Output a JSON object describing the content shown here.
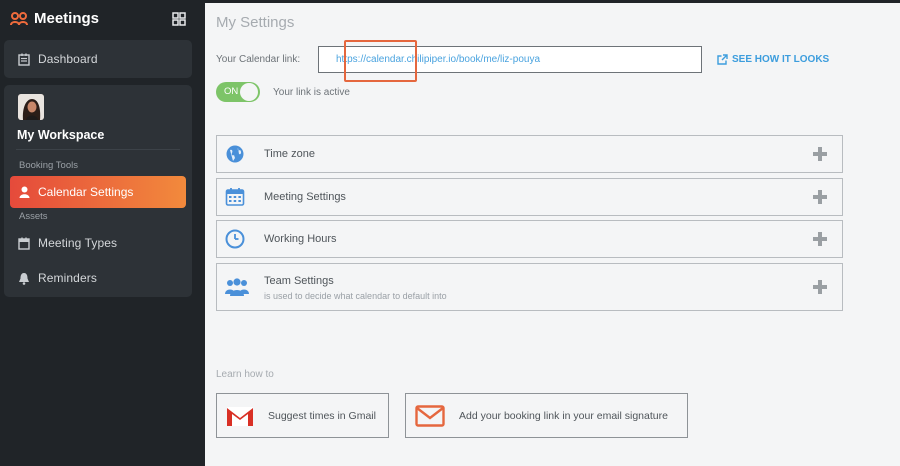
{
  "sidebar": {
    "brand": "Meetings",
    "nav": {
      "dashboard": "Dashboard"
    },
    "workspace": {
      "title": "My Workspace",
      "sections": {
        "booking_tools": "Booking Tools",
        "assets": "Assets"
      },
      "items": {
        "calendar_settings": "Calendar Settings",
        "meeting_types": "Meeting Types",
        "reminders": "Reminders"
      }
    }
  },
  "main": {
    "title": "My Settings",
    "calendar_label": "Your Calendar link:",
    "calendar_link": "https://calendar.chilipiper.io/book/me/liz-pouya",
    "see_link": "SEE HOW IT LOOKS",
    "toggle": {
      "label": "ON",
      "status": "Your link is active"
    },
    "accordion": [
      {
        "title": "Time zone",
        "icon": "globe-icon"
      },
      {
        "title": "Meeting Settings",
        "icon": "calendar-icon"
      },
      {
        "title": "Working Hours",
        "icon": "clock-icon"
      },
      {
        "title": "Team Settings",
        "subtitle": "is used to decide what calendar to default into",
        "icon": "team-icon"
      }
    ],
    "learn": {
      "label": "Learn how to",
      "gmail": "Suggest times in Gmail",
      "signature": "Add your booking link in your email signature"
    }
  },
  "colors": {
    "accent_start": "#e54a3b",
    "accent_end": "#f28a3c",
    "link": "#3c9ddd",
    "toggle_on": "#7dc468",
    "highlight": "#e5673e"
  }
}
